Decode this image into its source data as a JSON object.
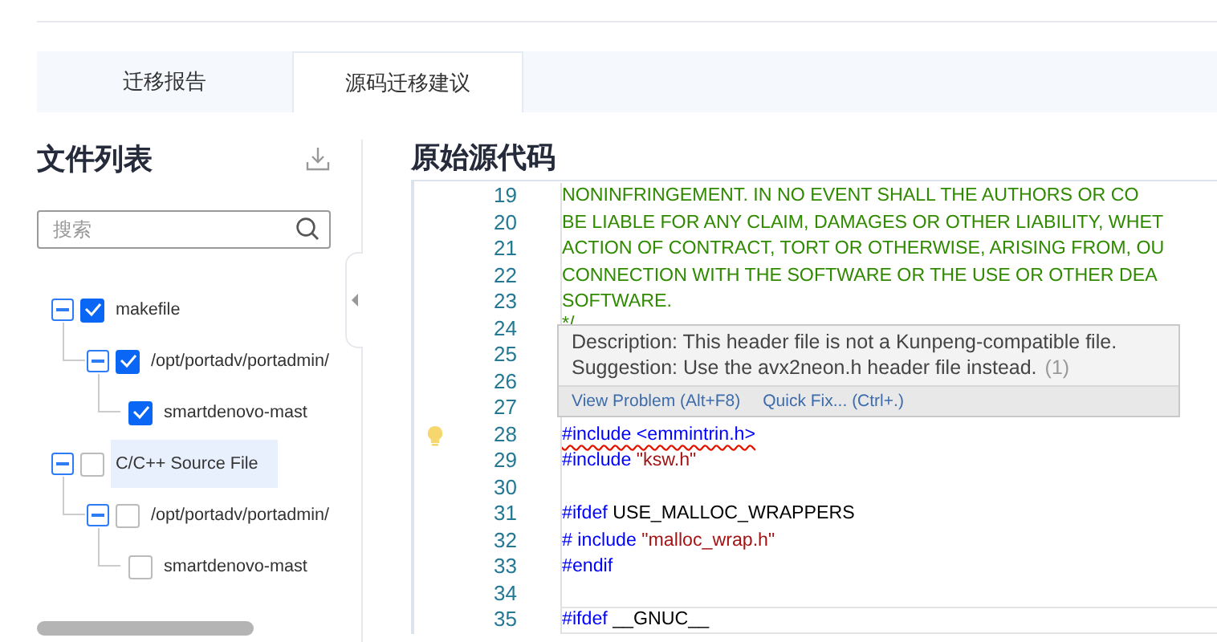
{
  "tabs": [
    {
      "label": "迁移报告",
      "selected": false
    },
    {
      "label": "源码迁移建议",
      "selected": true
    }
  ],
  "file_list": {
    "title": "文件列表",
    "search": {
      "placeholder": "搜索"
    },
    "tree": [
      {
        "label": "makefile",
        "checked": true,
        "expanded": true,
        "selected": false,
        "children": [
          {
            "label": "/opt/portadv/portadmin/",
            "checked": true,
            "expanded": true,
            "selected": false,
            "children": [
              {
                "label": "smartdenovo-mast",
                "checked": true,
                "selected": false
              }
            ]
          }
        ]
      },
      {
        "label": "C/C++ Source File",
        "checked": false,
        "expanded": true,
        "selected": true,
        "children": [
          {
            "label": "/opt/portadv/portadmin/",
            "checked": false,
            "expanded": true,
            "selected": false,
            "children": [
              {
                "label": "smartdenovo-mast",
                "checked": false,
                "selected": false
              }
            ]
          }
        ]
      }
    ]
  },
  "source": {
    "title": "原始源代码",
    "lines": [
      {
        "number": "19",
        "segments": [
          {
            "kind": "comment",
            "text": "NONINFRINGEMENT. IN NO EVENT SHALL THE AUTHORS OR CO"
          }
        ]
      },
      {
        "number": "20",
        "segments": [
          {
            "kind": "comment",
            "text": "BE LIABLE FOR ANY CLAIM, DAMAGES OR OTHER LIABILITY, WHET"
          }
        ]
      },
      {
        "number": "21",
        "segments": [
          {
            "kind": "comment",
            "text": "ACTION OF CONTRACT, TORT OR OTHERWISE, ARISING FROM, OU"
          }
        ]
      },
      {
        "number": "22",
        "segments": [
          {
            "kind": "comment",
            "text": "CONNECTION WITH THE SOFTWARE OR THE USE OR OTHER DEA"
          }
        ]
      },
      {
        "number": "23",
        "segments": [
          {
            "kind": "comment",
            "text": "SOFTWARE."
          }
        ]
      },
      {
        "number": "24",
        "segments": [
          {
            "kind": "comment",
            "text": "*/"
          }
        ]
      },
      {
        "number": "25"
      },
      {
        "number": "26"
      },
      {
        "number": "27"
      },
      {
        "number": "28",
        "hint": true,
        "segments": [
          {
            "kind": "keyword",
            "text": "#include <emmintrin.h>",
            "error": true
          }
        ]
      },
      {
        "number": "29",
        "segments": [
          {
            "kind": "keyword",
            "text": "#include "
          },
          {
            "kind": "string",
            "text": "\"ksw.h\""
          }
        ]
      },
      {
        "number": "30"
      },
      {
        "number": "31",
        "segments": [
          {
            "kind": "keyword",
            "text": "#ifdef "
          },
          {
            "kind": "plain",
            "text": "USE_MALLOC_WRAPPERS"
          }
        ]
      },
      {
        "number": "32",
        "segments": [
          {
            "kind": "keyword",
            "text": "#  include "
          },
          {
            "kind": "string",
            "text": "\"malloc_wrap.h\""
          }
        ]
      },
      {
        "number": "33",
        "segments": [
          {
            "kind": "keyword",
            "text": "#endif"
          }
        ]
      },
      {
        "number": "34"
      },
      {
        "number": "35",
        "current": true,
        "segments": [
          {
            "kind": "keyword",
            "text": "#ifdef "
          },
          {
            "kind": "plain",
            "text": "__GNUC__"
          }
        ]
      }
    ],
    "tooltip": {
      "description": "Description: This header file is not a Kunpeng-compatible file.",
      "suggestion": "Suggestion: Use the avx2neon.h header file instead.",
      "count": "(1)",
      "actions": [
        "View Problem (Alt+F8)",
        "Quick Fix... (Ctrl+.)"
      ]
    }
  }
}
